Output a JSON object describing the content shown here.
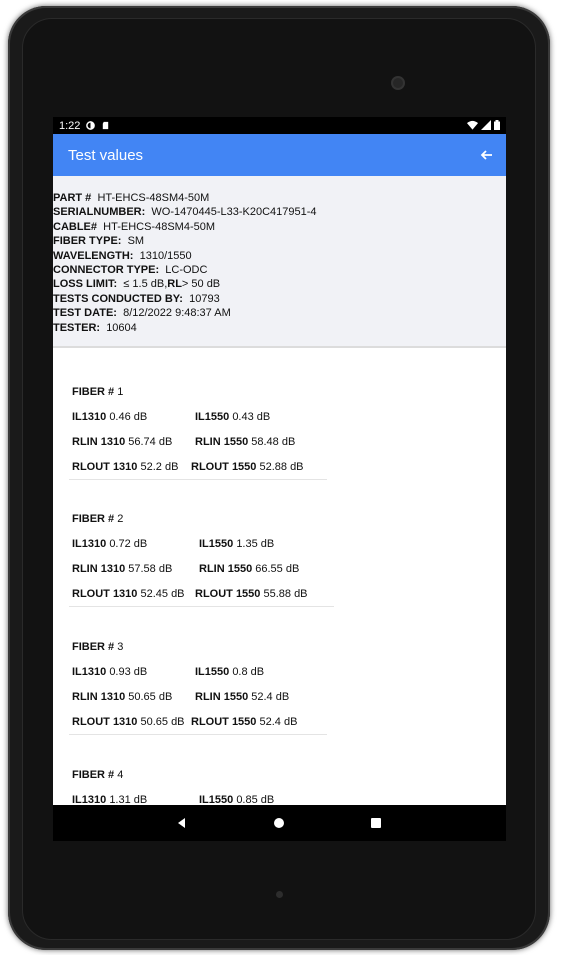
{
  "status_bar": {
    "time": "1:22"
  },
  "app_bar": {
    "title": "Test values"
  },
  "info": [
    {
      "key": "PART #",
      "value": "HT-EHCS-48SM4-50M"
    },
    {
      "key": "SERIALNUMBER:",
      "value": "WO-1470445-L33-K20C417951-4"
    },
    {
      "key": "CABLE#",
      "value": "HT-EHCS-48SM4-50M"
    },
    {
      "key": "FIBER TYPE:",
      "value": "SM"
    },
    {
      "key": "WAVELENGTH:",
      "value": "1310/1550"
    },
    {
      "key": "CONNECTOR TYPE:",
      "value": "LC-ODC"
    },
    {
      "key": "LOSS LIMIT:",
      "value": "≤ 1.5 dB,",
      "key2": "RL",
      "value2": "> 50 dB"
    },
    {
      "key": "TESTS CONDUCTED BY:",
      "value": "10793"
    },
    {
      "key": "TEST DATE:",
      "value": "8/12/2022 9:48:37 AM"
    },
    {
      "key": "TESTER:",
      "value": "10604"
    }
  ],
  "fibers": [
    {
      "label": "FIBER #",
      "num": "1",
      "il1310": "0.46 dB",
      "il1550": "0.43 dB",
      "rlin1310": "56.74 dB",
      "rlin1550": "58.48 dB",
      "rlout1310": "52.2 dB",
      "rlout1550": "52.88 dB"
    },
    {
      "label": "FIBER #",
      "num": "2",
      "il1310": "0.72 dB",
      "il1550": "1.35 dB",
      "rlin1310": "57.58 dB",
      "rlin1550": "66.55 dB",
      "rlout1310": "52.45 dB",
      "rlout1550": "55.88 dB"
    },
    {
      "label": "FIBER #",
      "num": "3",
      "il1310": "0.93 dB",
      "il1550": "0.8 dB",
      "rlin1310": "50.65 dB",
      "rlin1550": "52.4 dB",
      "rlout1310": "50.65 dB",
      "rlout1550": "52.4 dB"
    },
    {
      "label": "FIBER #",
      "num": "4",
      "il1310": "1.31 dB",
      "il1550": "0.85 dB"
    }
  ],
  "labels": {
    "il1310": "IL1310",
    "il1550": "IL1550",
    "rlin1310": "RLIN 1310",
    "rlin1550": "RLIN 1550",
    "rlout1310": "RLOUT 1310",
    "rlout1550": "RLOUT 1550"
  },
  "colors": {
    "app_bar": "#4285f4",
    "info_bg": "#f1f2f6"
  },
  "icons": {
    "back": "arrow-left-icon",
    "nav": [
      "back-triangle-icon",
      "home-circle-icon",
      "recents-square-icon"
    ]
  }
}
